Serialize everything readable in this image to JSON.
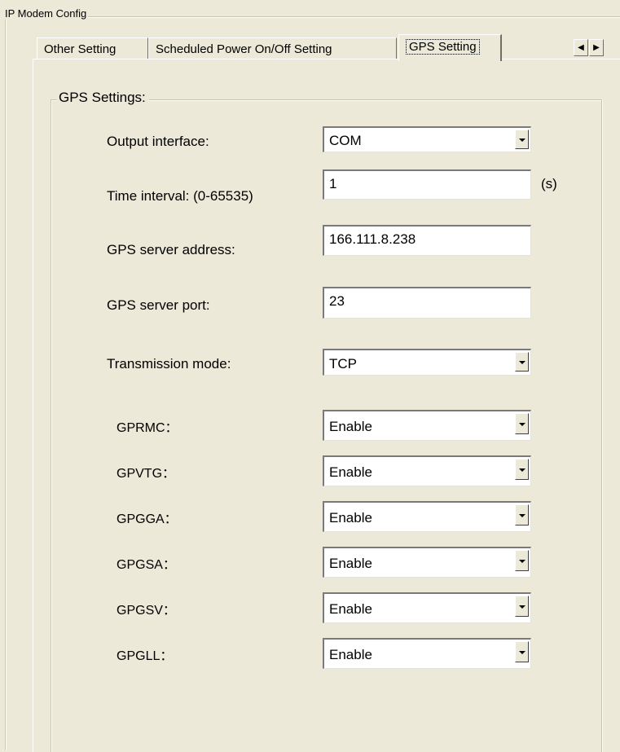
{
  "group_title": "IP Modem Config",
  "tabs": [
    {
      "label": "Other Setting"
    },
    {
      "label": "Scheduled Power On/Off Setting"
    },
    {
      "label": "GPS Setting"
    }
  ],
  "active_tab": "GPS Setting",
  "scroll": {
    "left": "◀",
    "right": "▶"
  },
  "gps": {
    "legend": "GPS Settings:",
    "output_interface": {
      "label": "Output interface:",
      "value": "COM"
    },
    "time_interval": {
      "label": "Time interval: (0-65535)",
      "value": "1",
      "unit": "(s)"
    },
    "server_address": {
      "label": "GPS server address:",
      "value": "166.111.8.238"
    },
    "server_port": {
      "label": "GPS server port:",
      "value": "23"
    },
    "transmission_mode": {
      "label": "Transmission mode:",
      "value": "TCP"
    },
    "nmea": [
      {
        "label": "GPRMC：",
        "value": "Enable"
      },
      {
        "label": "GPVTG：",
        "value": "Enable"
      },
      {
        "label": "GPGGA：",
        "value": "Enable"
      },
      {
        "label": "GPGSA：",
        "value": "Enable"
      },
      {
        "label": "GPGSV：",
        "value": "Enable"
      },
      {
        "label": "GPGLL：",
        "value": "Enable"
      }
    ]
  }
}
